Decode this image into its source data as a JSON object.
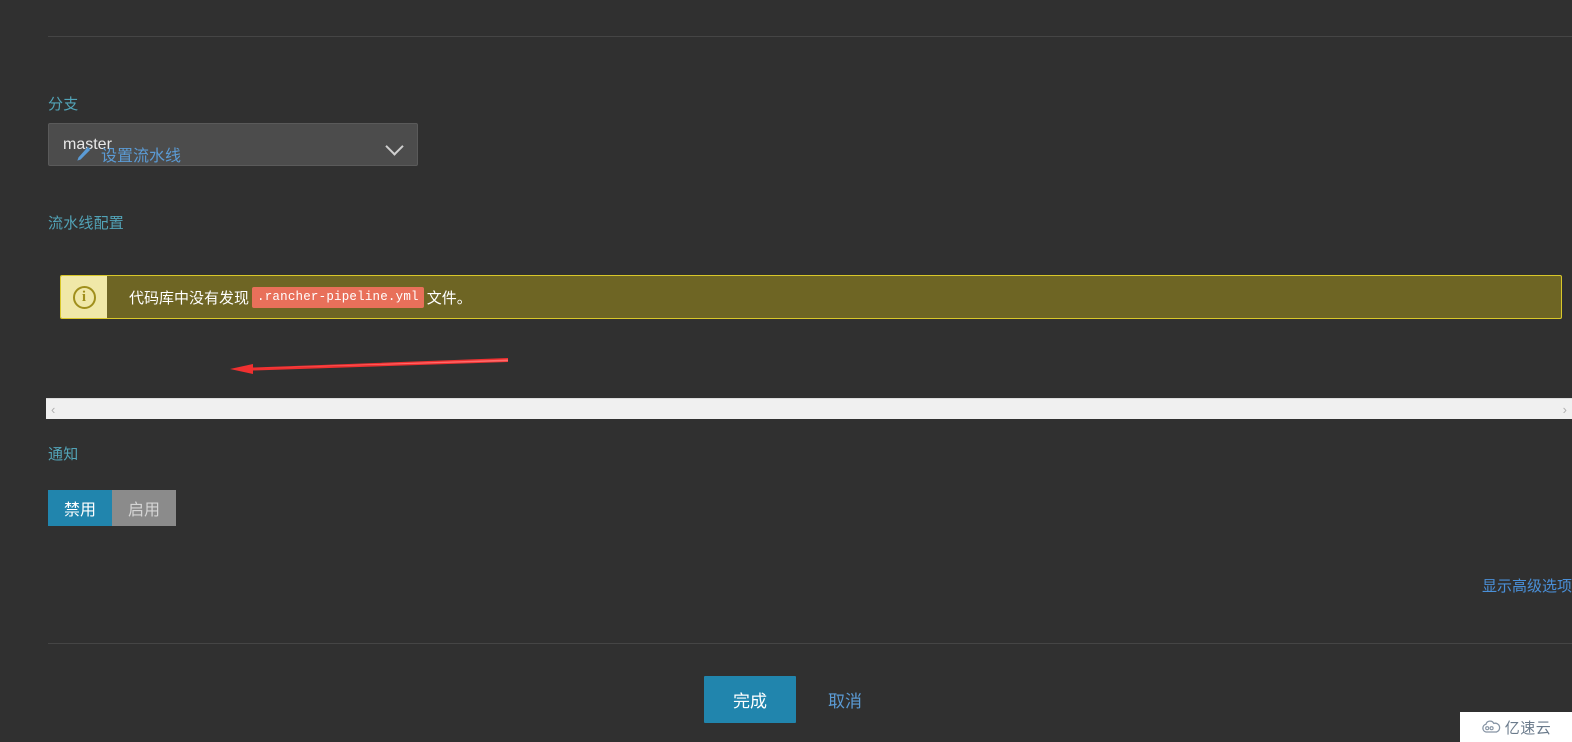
{
  "branch": {
    "label": "分支",
    "value": "master",
    "chevron_icon": "chevron-down-icon"
  },
  "pipeline": {
    "label": "流水线配置",
    "alert": {
      "icon": "info-circle-icon",
      "text_before": "代码库中没有发现",
      "code": ".rancher-pipeline.yml",
      "text_after": "文件。"
    },
    "set_pipeline": {
      "icon": "pencil-icon",
      "label": "设置流水线"
    }
  },
  "scrollbar": {
    "left_arrow": "‹",
    "right_arrow": "›"
  },
  "notification": {
    "label": "通知",
    "options": [
      {
        "label": "禁用",
        "state": "active"
      },
      {
        "label": "启用",
        "state": "inactive"
      }
    ]
  },
  "show_advanced": {
    "label": "显示高级选项"
  },
  "actions": {
    "primary_label": "完成",
    "cancel_label": "取消"
  },
  "watermark": {
    "icon": "cloud-icon",
    "text": "亿速云"
  },
  "colors": {
    "page_bg": "#303030",
    "accent_blue": "#2185ad",
    "link_blue": "#5b9bd5",
    "label_teal": "#52a3b7",
    "alert_bg": "#6e6524",
    "alert_border": "#d8c72a",
    "alert_icon_bg": "#f0e8a8",
    "code_chip_bg": "#e8705a",
    "annotation_red": "#f03030",
    "inactive_gray": "#8b8b8b"
  }
}
